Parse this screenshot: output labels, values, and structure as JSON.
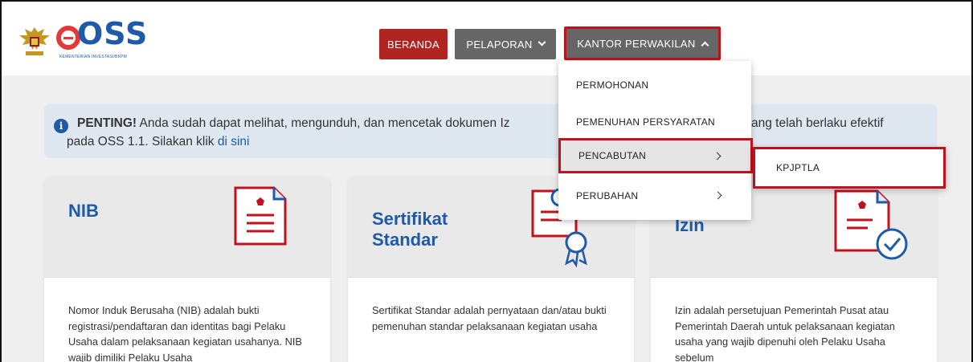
{
  "brand": {
    "logo_text": "OSS",
    "logo_subtext": "KEMENTERIAN INVESTASI/BKPM",
    "emblem": "garuda-emblem-icon"
  },
  "nav": {
    "beranda": "BERANDA",
    "pelaporan": "PELAPORAN",
    "kantor_perwakilan": "KANTOR PERWAKILAN"
  },
  "dropdown": {
    "items": [
      "PERMOHONAN",
      "PEMENUHAN PERSYARATAN",
      "PENCABUTAN",
      "PERUBAHAN"
    ],
    "active_index": 2,
    "submenu": [
      "KPJPTLA"
    ]
  },
  "alert": {
    "strong": "PENTING!",
    "text_part1": " Anda sudah dapat melihat, mengunduh, dan mencetak dokumen Iz",
    "text_part2": "ang telah berlaku efektif",
    "text_line2": "pada OSS 1.1. Silakan klik ",
    "link": "di sini"
  },
  "cards": [
    {
      "title": "NIB",
      "body": "Nomor Induk Berusaha (NIB) adalah bukti registrasi/pendaftaran dan identitas bagi Pelaku Usaha dalam pelaksanaan kegiatan usahanya. NIB wajib dimiliki Pelaku Usaha"
    },
    {
      "title": "Sertifikat Standar",
      "body": "Sertifikat Standar adalah pernyataan dan/atau bukti pemenuhan standar pelaksanaan kegiatan usaha"
    },
    {
      "title": "Izin",
      "body": "Izin adalah persetujuan Pemerintah Pusat atau Pemerintah Daerah untuk pelaksanaan kegiatan usaha yang wajib dipenuhi oleh Pelaku Usaha sebelum"
    }
  ],
  "colors": {
    "brand_blue": "#1f5aa8",
    "beranda_red": "#b02421",
    "nav_gray": "#666666",
    "highlight_red": "#c0111c"
  }
}
